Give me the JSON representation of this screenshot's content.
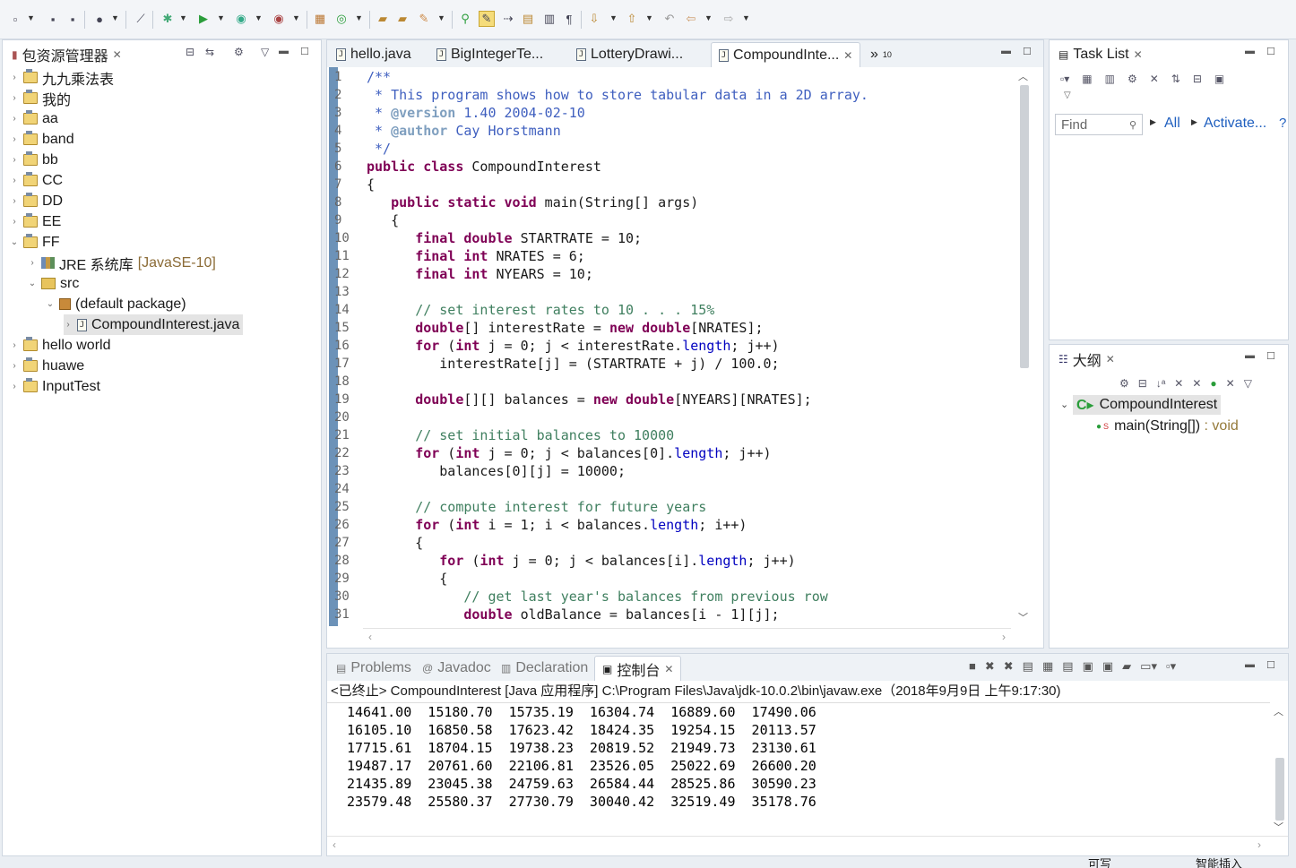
{
  "toolbar": {
    "icons": [
      "new-icon",
      "save-icon",
      "save-all-icon",
      "perspective-icon",
      "skip-breakpoints-icon",
      "debug-icon",
      "run-icon",
      "coverage-icon",
      "external-tools-icon",
      "new-java-project-icon",
      "new-package-icon",
      "open-type-icon",
      "open-task-icon",
      "search-icon",
      "toggle-mark-occurrences-icon",
      "toggle-block-selection-icon",
      "show-whitespace-icon",
      "next-annotation-icon",
      "previous-annotation-icon",
      "back-icon",
      "forward-icon"
    ]
  },
  "package_explorer": {
    "title": "包资源管理器",
    "items": [
      {
        "label": "九九乘法表",
        "indent": 0,
        "expanded": false,
        "type": "project"
      },
      {
        "label": "我的",
        "indent": 0,
        "expanded": false,
        "type": "project"
      },
      {
        "label": "aa",
        "indent": 0,
        "expanded": false,
        "type": "project"
      },
      {
        "label": "band",
        "indent": 0,
        "expanded": false,
        "type": "project"
      },
      {
        "label": "bb",
        "indent": 0,
        "expanded": false,
        "type": "project"
      },
      {
        "label": "CC",
        "indent": 0,
        "expanded": false,
        "type": "project"
      },
      {
        "label": "DD",
        "indent": 0,
        "expanded": false,
        "type": "project"
      },
      {
        "label": "EE",
        "indent": 0,
        "expanded": false,
        "type": "project"
      },
      {
        "label": "FF",
        "indent": 0,
        "expanded": true,
        "type": "project"
      },
      {
        "label": "JRE 系统库",
        "suffix": "[JavaSE-10]",
        "indent": 1,
        "expanded": false,
        "type": "library"
      },
      {
        "label": "src",
        "indent": 1,
        "expanded": true,
        "type": "source"
      },
      {
        "label": "(default package)",
        "indent": 2,
        "expanded": true,
        "type": "package"
      },
      {
        "label": "CompoundInterest.java",
        "indent": 3,
        "expanded": false,
        "type": "file",
        "selected": true
      },
      {
        "label": "hello world",
        "indent": 0,
        "expanded": false,
        "type": "project"
      },
      {
        "label": "huawe",
        "indent": 0,
        "expanded": false,
        "type": "project"
      },
      {
        "label": "InputTest",
        "indent": 0,
        "expanded": false,
        "type": "project"
      }
    ]
  },
  "editor": {
    "tabs": [
      {
        "label": "hello.java",
        "active": false
      },
      {
        "label": "BigIntegerTe...",
        "active": false
      },
      {
        "label": "LotteryDrawi...",
        "active": false
      },
      {
        "label": "CompoundInte...",
        "active": true
      }
    ],
    "overflow": "»",
    "overflow_count": "10",
    "lines": [
      [
        [
          "jd",
          "/**"
        ]
      ],
      [
        [
          "jd",
          " * This program shows how to store tabular data in a 2D array."
        ]
      ],
      [
        [
          "jd",
          " * "
        ],
        [
          "jt",
          "@version"
        ],
        [
          "jd",
          " 1.40 2004-02-10"
        ]
      ],
      [
        [
          "jd",
          " * "
        ],
        [
          "jt",
          "@author"
        ],
        [
          "jd",
          " Cay Horstmann"
        ]
      ],
      [
        [
          "jd",
          " */"
        ]
      ],
      [
        [
          "kw",
          "public"
        ],
        [
          "t",
          " "
        ],
        [
          "kw",
          "class"
        ],
        [
          "t",
          " CompoundInterest"
        ]
      ],
      [
        [
          "t",
          "{"
        ]
      ],
      [
        [
          "t",
          "   "
        ],
        [
          "kw",
          "public"
        ],
        [
          "t",
          " "
        ],
        [
          "kw",
          "static"
        ],
        [
          "t",
          " "
        ],
        [
          "kw",
          "void"
        ],
        [
          "t",
          " main(String[] args)"
        ]
      ],
      [
        [
          "t",
          "   {"
        ]
      ],
      [
        [
          "t",
          "      "
        ],
        [
          "kw",
          "final"
        ],
        [
          "t",
          " "
        ],
        [
          "kw",
          "double"
        ],
        [
          "t",
          " STARTRATE = 10;"
        ]
      ],
      [
        [
          "t",
          "      "
        ],
        [
          "kw",
          "final"
        ],
        [
          "t",
          " "
        ],
        [
          "kw",
          "int"
        ],
        [
          "t",
          " NRATES = 6;"
        ]
      ],
      [
        [
          "t",
          "      "
        ],
        [
          "kw",
          "final"
        ],
        [
          "t",
          " "
        ],
        [
          "kw",
          "int"
        ],
        [
          "t",
          " NYEARS = 10;"
        ]
      ],
      [
        [
          "t",
          ""
        ]
      ],
      [
        [
          "t",
          "      "
        ],
        [
          "cm",
          "// set interest rates to 10 . . . 15%"
        ]
      ],
      [
        [
          "t",
          "      "
        ],
        [
          "kw",
          "double"
        ],
        [
          "t",
          "[] interestRate = "
        ],
        [
          "kw",
          "new"
        ],
        [
          "t",
          " "
        ],
        [
          "kw",
          "double"
        ],
        [
          "t",
          "[NRATES];"
        ]
      ],
      [
        [
          "t",
          "      "
        ],
        [
          "kw",
          "for"
        ],
        [
          "t",
          " ("
        ],
        [
          "kw",
          "int"
        ],
        [
          "t",
          " j = 0; j < interestRate."
        ],
        [
          "fld",
          "length"
        ],
        [
          "t",
          "; j++)"
        ]
      ],
      [
        [
          "t",
          "         interestRate[j] = (STARTRATE + j) / 100.0;"
        ]
      ],
      [
        [
          "t",
          ""
        ]
      ],
      [
        [
          "t",
          "      "
        ],
        [
          "kw",
          "double"
        ],
        [
          "t",
          "[][] balances = "
        ],
        [
          "kw",
          "new"
        ],
        [
          "t",
          " "
        ],
        [
          "kw",
          "double"
        ],
        [
          "t",
          "[NYEARS][NRATES];"
        ]
      ],
      [
        [
          "t",
          ""
        ]
      ],
      [
        [
          "t",
          "      "
        ],
        [
          "cm",
          "// set initial balances to 10000"
        ]
      ],
      [
        [
          "t",
          "      "
        ],
        [
          "kw",
          "for"
        ],
        [
          "t",
          " ("
        ],
        [
          "kw",
          "int"
        ],
        [
          "t",
          " j = 0; j < balances[0]."
        ],
        [
          "fld",
          "length"
        ],
        [
          "t",
          "; j++)"
        ]
      ],
      [
        [
          "t",
          "         balances[0][j] = 10000;"
        ]
      ],
      [
        [
          "t",
          ""
        ]
      ],
      [
        [
          "t",
          "      "
        ],
        [
          "cm",
          "// compute interest for future years"
        ]
      ],
      [
        [
          "t",
          "      "
        ],
        [
          "kw",
          "for"
        ],
        [
          "t",
          " ("
        ],
        [
          "kw",
          "int"
        ],
        [
          "t",
          " i = 1; i < balances."
        ],
        [
          "fld",
          "length"
        ],
        [
          "t",
          "; i++)"
        ]
      ],
      [
        [
          "t",
          "      {"
        ]
      ],
      [
        [
          "t",
          "         "
        ],
        [
          "kw",
          "for"
        ],
        [
          "t",
          " ("
        ],
        [
          "kw",
          "int"
        ],
        [
          "t",
          " j = 0; j < balances[i]."
        ],
        [
          "fld",
          "length"
        ],
        [
          "t",
          "; j++)"
        ]
      ],
      [
        [
          "t",
          "         {"
        ]
      ],
      [
        [
          "t",
          "            "
        ],
        [
          "cm",
          "// get last year's balances from previous row"
        ]
      ],
      [
        [
          "t",
          "            "
        ],
        [
          "kw",
          "double"
        ],
        [
          "t",
          " oldBalance = balances[i - 1][j];"
        ]
      ]
    ]
  },
  "task_list": {
    "title": "Task List",
    "find_placeholder": "Find",
    "all_label": "All",
    "activate_label": "Activate...",
    "help_label": "?"
  },
  "outline": {
    "title": "大纲",
    "class_name": "CompoundInterest",
    "method_name": "main(String[])",
    "method_type": " : void",
    "static_marker": "S"
  },
  "console": {
    "tabs": [
      {
        "label": "Problems",
        "active": false
      },
      {
        "label": "Javadoc",
        "active": false
      },
      {
        "label": "Declaration",
        "active": false
      },
      {
        "label": "控制台",
        "active": true
      }
    ],
    "header": "<已终止> CompoundInterest [Java 应用程序] C:\\Program Files\\Java\\jdk-10.0.2\\bin\\javaw.exe（2018年9月9日 上午9:17:30)",
    "rows": [
      "14641.00  15180.70  15735.19  16304.74  16889.60  17490.06",
      "16105.10  16850.58  17623.42  18424.35  19254.15  20113.57",
      "17715.61  18704.15  19738.23  20819.52  21949.73  23130.61",
      "19487.17  20761.60  22106.81  23526.05  25022.69  26600.20",
      "21435.89  23045.38  24759.63  26584.44  28525.86  30590.23",
      "23579.48  25580.37  27730.79  30040.42  32519.49  35178.76"
    ]
  },
  "status": {
    "writable": "可写",
    "insert_mode": "智能插入"
  }
}
